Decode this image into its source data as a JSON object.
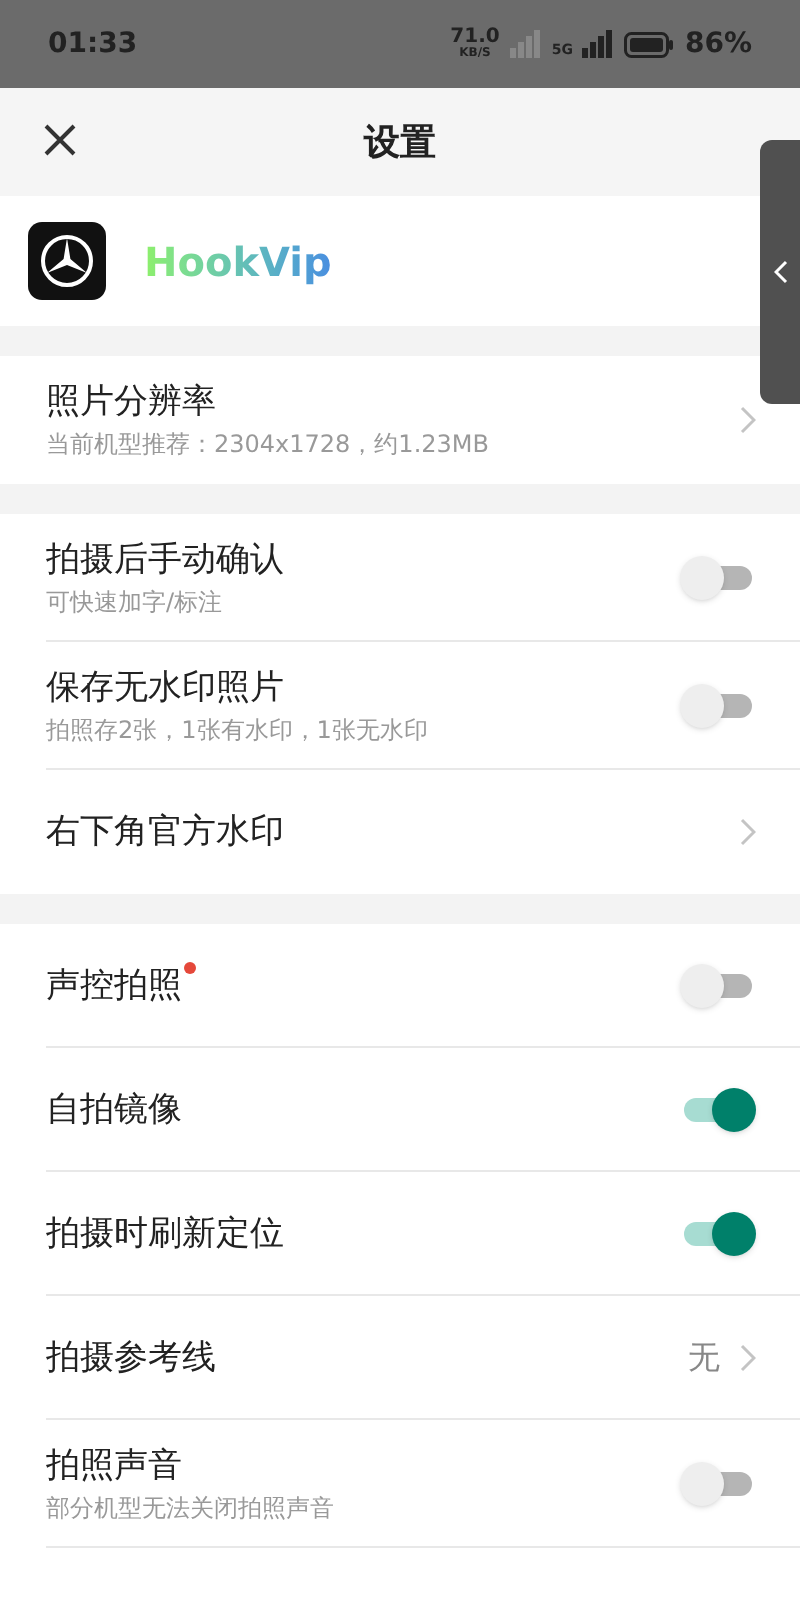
{
  "status_bar": {
    "time": "01:33",
    "speed": "71.0",
    "speed_unit": "KB/S",
    "network": "5G",
    "battery": "86%"
  },
  "header": {
    "title": "设置"
  },
  "app": {
    "name": "HookVip"
  },
  "sections": [
    [
      {
        "kind": "link",
        "title": "照片分辨率",
        "subtitle": "当前机型推荐：2304x1728，约1.23MB"
      }
    ],
    [
      {
        "kind": "toggle",
        "title": "拍摄后手动确认",
        "subtitle": "可快速加字/标注",
        "on": false
      },
      {
        "kind": "toggle",
        "title": "保存无水印照片",
        "subtitle": "拍照存2张，1张有水印，1张无水印",
        "on": false
      },
      {
        "kind": "link",
        "title": "右下角官方水印"
      }
    ],
    [
      {
        "kind": "toggle",
        "title": "声控拍照",
        "dot": true,
        "on": false
      },
      {
        "kind": "toggle",
        "title": "自拍镜像",
        "on": true
      },
      {
        "kind": "toggle",
        "title": "拍摄时刷新定位",
        "on": true
      },
      {
        "kind": "link",
        "title": "拍摄参考线",
        "value": "无"
      },
      {
        "kind": "toggle",
        "title": "拍照声音",
        "subtitle": "部分机型无法关闭拍照声音",
        "on": false
      }
    ]
  ]
}
